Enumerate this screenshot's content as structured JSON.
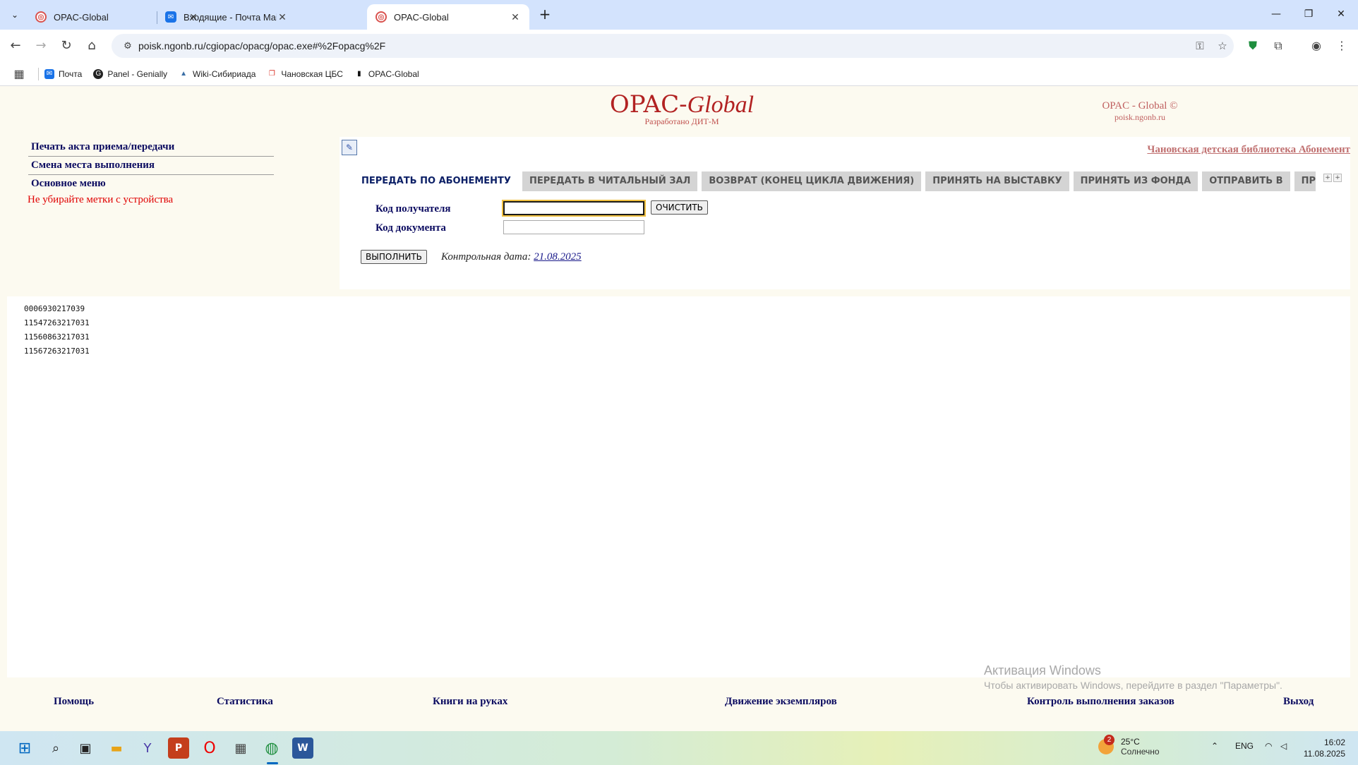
{
  "browser": {
    "tabs": [
      {
        "title": "OPAC-Global",
        "active": false,
        "icon": "opac-icon"
      },
      {
        "title": "Входящие - Почта Mail",
        "active": false,
        "icon": "mail-icon"
      },
      {
        "title": "OPAC-Global",
        "active": true,
        "icon": "opac-icon"
      }
    ],
    "url": "poisk.ngonb.ru/cgiopac/opacg/opac.exe#%2Fopacg%2F",
    "bookmarks": [
      {
        "label": "Почта",
        "icon": "mail-icon"
      },
      {
        "label": "Panel - Genially",
        "icon": "genially-icon"
      },
      {
        "label": "Wiki-Сибириада",
        "icon": "wiki-icon"
      },
      {
        "label": "Чановская ЦБС",
        "icon": "bookmark-icon"
      },
      {
        "label": "OPAC-Global",
        "icon": "opac-icon"
      }
    ]
  },
  "header": {
    "logo_main": "OPAC-",
    "logo_italic": "Global",
    "logo_sub": "Разработано ДИТ-М",
    "logo_right_title": "OPAC - Global ©",
    "logo_right_url": "poisk.ngonb.ru"
  },
  "left_menu": {
    "items": [
      "Печать акта приема/передачи",
      "Смена места выполнения",
      "Основное меню"
    ],
    "warning": "Не убирайте метки с устройства"
  },
  "panel": {
    "library_link": "Чановская детская библиотека Абонемент",
    "tabs": [
      {
        "label": "ПЕРЕДАТЬ ПО АБОНЕМЕНТУ",
        "active": true
      },
      {
        "label": "ПЕРЕДАТЬ В ЧИТАЛЬНЫЙ ЗАЛ",
        "active": false
      },
      {
        "label": "ВОЗВРАТ (КОНЕЦ ЦИКЛА ДВИЖЕНИЯ)",
        "active": false
      },
      {
        "label": "ПРИНЯТЬ НА ВЫСТАВКУ",
        "active": false
      },
      {
        "label": "ПРИНЯТЬ ИЗ ФОНДА",
        "active": false
      },
      {
        "label": "ОТПРАВИТЬ В",
        "active": false
      },
      {
        "label": "ПРИНЯТЬ В ФОНД",
        "active": false
      }
    ],
    "recipient_label": "Код получателя",
    "recipient_value": "",
    "document_label": "Код документа",
    "document_value": "",
    "clear_button": "ОЧИСТИТЬ",
    "execute_button": "ВЫПОЛНИТЬ",
    "control_date_label": "Контрольная дата:",
    "control_date_value": "21.08.2025"
  },
  "codes": [
    "0006930217039",
    "11547263217031",
    "11560863217031",
    "11567263217031"
  ],
  "footer": {
    "links": [
      "Помощь",
      "Статистика",
      "Книги на руках",
      "Движение экземпляров",
      "Контроль выполнения заказов",
      "Выход"
    ]
  },
  "activation": {
    "title": "Активация Windows",
    "text": "Чтобы активировать Windows, перейдите в раздел \"Параметры\"."
  },
  "taskbar": {
    "weather_temp": "25°C",
    "weather_desc": "Солнечно",
    "weather_badge": "2",
    "lang": "ENG",
    "time": "16:02",
    "date": "11.08.2025"
  }
}
